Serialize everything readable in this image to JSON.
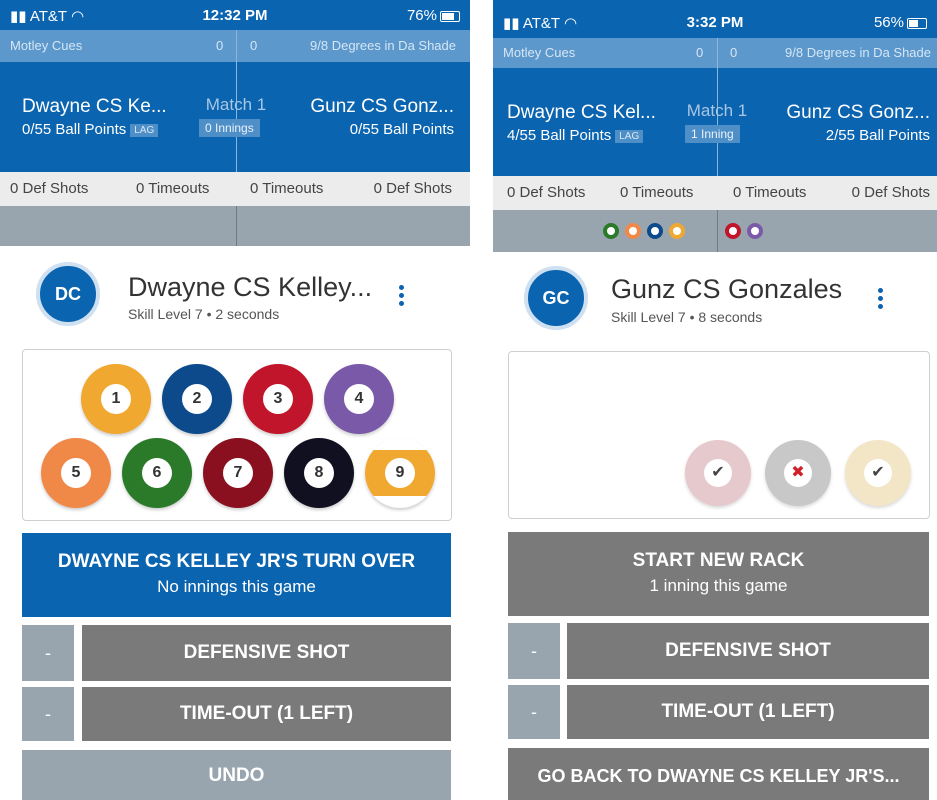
{
  "colors": {
    "primary_blue": "#0b64b0",
    "team_bar_blue": "#5c98cc",
    "stats_bg": "#ececec",
    "gray_button": "#7a7a7a",
    "light_gray_button": "#98a5ae"
  },
  "left": {
    "status": {
      "carrier": "AT&T",
      "time": "12:32 PM",
      "battery": "76%",
      "battery_level": 0.76
    },
    "teams": {
      "home_team": "Motley Cues",
      "home_score": "0",
      "away_score": "0",
      "away_team": "9/8 Degrees in Da Shade"
    },
    "match": {
      "player1_name": "Dwayne CS Ke...",
      "player1_points": "0/55 Ball Points",
      "lag_label": "LAG",
      "match_label": "Match 1",
      "innings_label": "0 Innings",
      "player2_name": "Gunz CS Gonz...",
      "player2_points": "0/55 Ball Points"
    },
    "stats": {
      "p1_def_shots": "0 Def Shots",
      "p1_timeouts": "0 Timeouts",
      "p2_timeouts": "0 Timeouts",
      "p2_def_shots": "0 Def Shots"
    },
    "shooter": {
      "initials": "DC",
      "name": "Dwayne CS Kelley...",
      "skill": "Skill Level 7 • 2 seconds"
    },
    "balls": [
      {
        "number": "1",
        "color": "#f0a830"
      },
      {
        "number": "2",
        "color": "#0d4a8c"
      },
      {
        "number": "3",
        "color": "#c0152a"
      },
      {
        "number": "4",
        "color": "#7a5aa8"
      },
      {
        "number": "5",
        "color": "#f08848"
      },
      {
        "number": "6",
        "color": "#2a7a2a"
      },
      {
        "number": "7",
        "color": "#8a1020"
      },
      {
        "number": "8",
        "color": "#101020"
      },
      {
        "number": "9",
        "color": "#f0a830",
        "stripe": true
      }
    ],
    "primary_button": {
      "title": "DWAYNE CS KELLEY JR'S TURN OVER",
      "subtitle": "No innings this game"
    },
    "defensive_button": {
      "minus": "-",
      "label": "DEFENSIVE SHOT"
    },
    "timeout_button": {
      "minus": "-",
      "label": "TIME-OUT (1 LEFT)"
    },
    "bottom_button": {
      "label": "UNDO"
    }
  },
  "right": {
    "status": {
      "carrier": "AT&T",
      "time": "3:32 PM",
      "battery": "56%",
      "battery_level": 0.56
    },
    "teams": {
      "home_team": "Motley Cues",
      "home_score": "0",
      "away_score": "0",
      "away_team": "9/8 Degrees in Da Shade"
    },
    "match": {
      "player1_name": "Dwayne CS Kel...",
      "player1_points": "4/55 Ball Points",
      "lag_label": "LAG",
      "match_label": "Match 1",
      "innings_label": "1 Inning",
      "player2_name": "Gunz CS Gonz...",
      "player2_points": "2/55 Ball Points"
    },
    "stats": {
      "p1_def_shots": "0 Def Shots",
      "p1_timeouts": "0 Timeouts",
      "p2_timeouts": "0 Timeouts",
      "p2_def_shots": "0 Def Shots"
    },
    "pocketed_left": [
      "#2a7a2a",
      "#f08848",
      "#0d4a8c",
      "#f0a830"
    ],
    "pocketed_right": [
      "#c0152a",
      "#7a5aa8"
    ],
    "shooter": {
      "initials": "GC",
      "name": "Gunz CS Gonzales",
      "skill": "Skill Level 7 • 8 seconds"
    },
    "action_circles": [
      {
        "name": "confirm-check-icon",
        "color": "#e6c9cc",
        "glyph": "✔",
        "glyph_color": "#444"
      },
      {
        "name": "cancel-x-icon",
        "color": "#c8c8c8",
        "glyph": "✖",
        "glyph_color": "#d0202a"
      },
      {
        "name": "confirm-check-icon-2",
        "color": "#f3e6c7",
        "glyph": "✔",
        "glyph_color": "#444"
      }
    ],
    "primary_button": {
      "title": "START NEW RACK",
      "subtitle": "1 inning this game"
    },
    "defensive_button": {
      "minus": "-",
      "label": "DEFENSIVE SHOT"
    },
    "timeout_button": {
      "minus": "-",
      "label": "TIME-OUT (1 LEFT)"
    },
    "bottom_button": {
      "label": "GO BACK TO DWAYNE CS KELLEY JR'S..."
    }
  }
}
